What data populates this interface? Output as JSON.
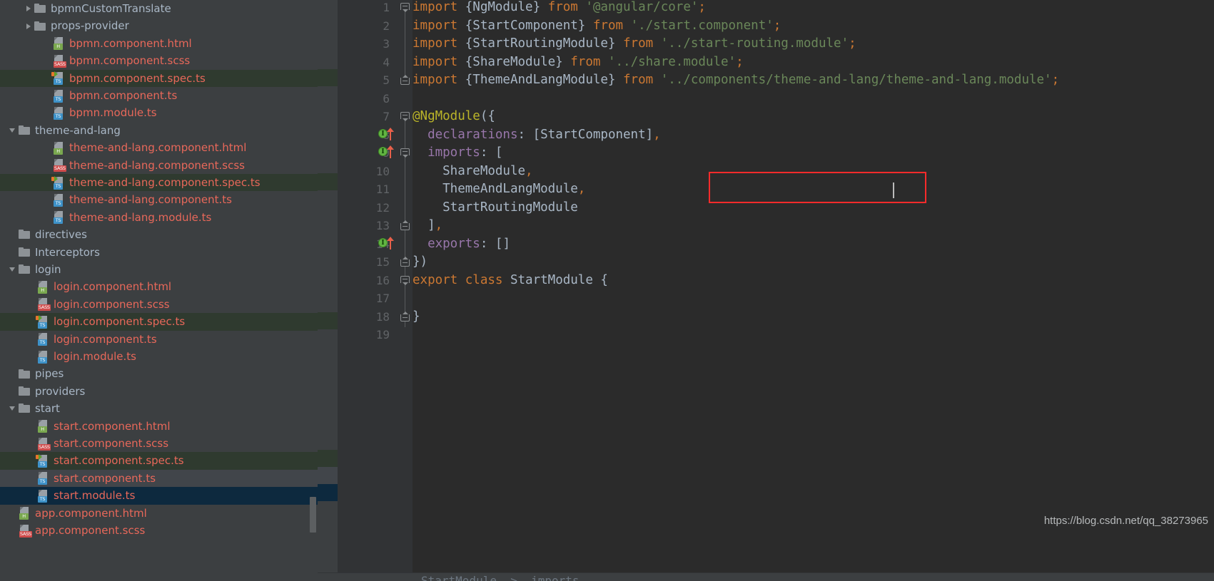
{
  "window": {
    "theme_background": "#2b2b2b",
    "sidebar_background": "#3c3f41",
    "accent_selection_blue": "#0d293e",
    "accent_selection_green": "#2f3a2f",
    "highlight_red": "#ff2b2b"
  },
  "sidebar": {
    "scrollbar": {
      "color": "#5c5f61"
    },
    "items": [
      {
        "label": "bpmnCustomTranslate",
        "kind": "folder",
        "indent": 48,
        "arrow": "right",
        "state": "none"
      },
      {
        "label": "props-provider",
        "kind": "folder",
        "indent": 48,
        "arrow": "right",
        "state": "none"
      },
      {
        "label": "bpmn.component.html",
        "kind": "file",
        "badge": "H",
        "indent": 74,
        "arrow": "none",
        "state": "none"
      },
      {
        "label": "bpmn.component.scss",
        "kind": "file",
        "badge": "SASS",
        "indent": 74,
        "arrow": "none",
        "state": "none"
      },
      {
        "label": "bpmn.component.spec.ts",
        "kind": "file",
        "badge": "TS",
        "spec": true,
        "indent": 74,
        "arrow": "none",
        "state": "green"
      },
      {
        "label": "bpmn.component.ts",
        "kind": "file",
        "badge": "TS",
        "indent": 74,
        "arrow": "none",
        "state": "none"
      },
      {
        "label": "bpmn.module.ts",
        "kind": "file",
        "badge": "TS",
        "indent": 74,
        "arrow": "none",
        "state": "none"
      },
      {
        "label": "theme-and-lang",
        "kind": "folder",
        "indent": 26,
        "arrow": "down",
        "state": "none"
      },
      {
        "label": "theme-and-lang.component.html",
        "kind": "file",
        "badge": "H",
        "indent": 74,
        "arrow": "none",
        "state": "none"
      },
      {
        "label": "theme-and-lang.component.scss",
        "kind": "file",
        "badge": "SASS",
        "indent": 74,
        "arrow": "none",
        "state": "none"
      },
      {
        "label": "theme-and-lang.component.spec.ts",
        "kind": "file",
        "badge": "TS",
        "spec": true,
        "indent": 74,
        "arrow": "none",
        "state": "green"
      },
      {
        "label": "theme-and-lang.component.ts",
        "kind": "file",
        "badge": "TS",
        "indent": 74,
        "arrow": "none",
        "state": "none"
      },
      {
        "label": "theme-and-lang.module.ts",
        "kind": "file",
        "badge": "TS",
        "indent": 74,
        "arrow": "none",
        "state": "none"
      },
      {
        "label": "directives",
        "kind": "folder",
        "indent": 26,
        "arrow": "none",
        "state": "none"
      },
      {
        "label": "Interceptors",
        "kind": "folder",
        "indent": 26,
        "arrow": "none",
        "state": "none"
      },
      {
        "label": "login",
        "kind": "folder",
        "indent": 26,
        "arrow": "down",
        "state": "none"
      },
      {
        "label": "login.component.html",
        "kind": "file",
        "badge": "H",
        "indent": 52,
        "arrow": "none",
        "state": "none"
      },
      {
        "label": "login.component.scss",
        "kind": "file",
        "badge": "SASS",
        "indent": 52,
        "arrow": "none",
        "state": "none"
      },
      {
        "label": "login.component.spec.ts",
        "kind": "file",
        "badge": "TS",
        "spec": true,
        "indent": 52,
        "arrow": "none",
        "state": "green"
      },
      {
        "label": "login.component.ts",
        "kind": "file",
        "badge": "TS",
        "indent": 52,
        "arrow": "none",
        "state": "none"
      },
      {
        "label": "login.module.ts",
        "kind": "file",
        "badge": "TS",
        "indent": 52,
        "arrow": "none",
        "state": "none"
      },
      {
        "label": "pipes",
        "kind": "folder",
        "indent": 26,
        "arrow": "none",
        "state": "none"
      },
      {
        "label": "providers",
        "kind": "folder",
        "indent": 26,
        "arrow": "none",
        "state": "none"
      },
      {
        "label": "start",
        "kind": "folder",
        "indent": 26,
        "arrow": "down",
        "state": "none"
      },
      {
        "label": "start.component.html",
        "kind": "file",
        "badge": "H",
        "indent": 52,
        "arrow": "none",
        "state": "none"
      },
      {
        "label": "start.component.scss",
        "kind": "file",
        "badge": "SASS",
        "indent": 52,
        "arrow": "none",
        "state": "none"
      },
      {
        "label": "start.component.spec.ts",
        "kind": "file",
        "badge": "TS",
        "spec": true,
        "indent": 52,
        "arrow": "none",
        "state": "green"
      },
      {
        "label": "start.component.ts",
        "kind": "file",
        "badge": "TS",
        "indent": 52,
        "arrow": "none",
        "state": "grey"
      },
      {
        "label": "start.module.ts",
        "kind": "file",
        "badge": "TS",
        "indent": 52,
        "arrow": "none",
        "state": "blue"
      },
      {
        "label": "app.component.html",
        "kind": "file",
        "badge": "H",
        "indent": 26,
        "arrow": "none",
        "state": "none"
      },
      {
        "label": "app.component.scss",
        "kind": "file",
        "badge": "SASS",
        "indent": 26,
        "arrow": "none",
        "state": "none"
      }
    ]
  },
  "editor": {
    "line_numbers": [
      "1",
      "2",
      "3",
      "4",
      "5",
      "6",
      "7",
      "8",
      "9",
      "10",
      "11",
      "12",
      "13",
      "14",
      "15",
      "16",
      "17",
      "18",
      "19"
    ],
    "lines": [
      {
        "n": 1,
        "tokens": [
          {
            "t": "import",
            "c": "kw"
          },
          {
            "t": " {NgModule} ",
            "c": "txt"
          },
          {
            "t": "from",
            "c": "kw"
          },
          {
            "t": " ",
            "c": "txt"
          },
          {
            "t": "'@angular/core'",
            "c": "str"
          },
          {
            "t": ";",
            "c": "kw"
          }
        ]
      },
      {
        "n": 2,
        "tokens": [
          {
            "t": "import",
            "c": "kw"
          },
          {
            "t": " {StartComponent} ",
            "c": "txt"
          },
          {
            "t": "from",
            "c": "kw"
          },
          {
            "t": " ",
            "c": "txt"
          },
          {
            "t": "'./start.component'",
            "c": "str"
          },
          {
            "t": ";",
            "c": "kw"
          }
        ]
      },
      {
        "n": 3,
        "tokens": [
          {
            "t": "import",
            "c": "kw"
          },
          {
            "t": " {StartRoutingModule} ",
            "c": "txt"
          },
          {
            "t": "from",
            "c": "kw"
          },
          {
            "t": " ",
            "c": "txt"
          },
          {
            "t": "'../start-routing.module'",
            "c": "str"
          },
          {
            "t": ";",
            "c": "kw"
          }
        ]
      },
      {
        "n": 4,
        "tokens": [
          {
            "t": "import",
            "c": "kw"
          },
          {
            "t": " {ShareModule} ",
            "c": "txt"
          },
          {
            "t": "from",
            "c": "kw"
          },
          {
            "t": " ",
            "c": "txt"
          },
          {
            "t": "'../share.module'",
            "c": "str"
          },
          {
            "t": ";",
            "c": "kw"
          }
        ]
      },
      {
        "n": 5,
        "tokens": [
          {
            "t": "import",
            "c": "kw"
          },
          {
            "t": " {ThemeAndLangModule} ",
            "c": "txt"
          },
          {
            "t": "from",
            "c": "kw"
          },
          {
            "t": " ",
            "c": "txt"
          },
          {
            "t": "'../components/theme-and-lang/theme-and-lang.module'",
            "c": "str"
          },
          {
            "t": ";",
            "c": "kw"
          }
        ]
      },
      {
        "n": 6,
        "tokens": []
      },
      {
        "n": 7,
        "tokens": [
          {
            "t": "@NgModule",
            "c": "ann"
          },
          {
            "t": "({",
            "c": "txt"
          }
        ]
      },
      {
        "n": 8,
        "tokens": [
          {
            "t": "  ",
            "c": "txt"
          },
          {
            "t": "declarations",
            "c": "prop"
          },
          {
            "t": ": [StartComponent]",
            "c": "txt"
          },
          {
            "t": ",",
            "c": "kw"
          }
        ]
      },
      {
        "n": 9,
        "tokens": [
          {
            "t": "  ",
            "c": "txt"
          },
          {
            "t": "imports",
            "c": "prop"
          },
          {
            "t": ": [",
            "c": "txt"
          }
        ]
      },
      {
        "n": 10,
        "tokens": [
          {
            "t": "    ShareModule",
            "c": "txt"
          },
          {
            "t": ",",
            "c": "kw"
          }
        ]
      },
      {
        "n": 11,
        "tokens": [
          {
            "t": "    ThemeAndLangModule",
            "c": "txt"
          },
          {
            "t": ",",
            "c": "kw"
          }
        ]
      },
      {
        "n": 12,
        "tokens": [
          {
            "t": "    StartRoutingModule",
            "c": "txt"
          }
        ]
      },
      {
        "n": 13,
        "tokens": [
          {
            "t": "  ]",
            "c": "txt"
          },
          {
            "t": ",",
            "c": "kw"
          }
        ]
      },
      {
        "n": 14,
        "tokens": [
          {
            "t": "  ",
            "c": "txt"
          },
          {
            "t": "exports",
            "c": "prop"
          },
          {
            "t": ": []",
            "c": "txt"
          }
        ]
      },
      {
        "n": 15,
        "tokens": [
          {
            "t": "})",
            "c": "txt"
          }
        ]
      },
      {
        "n": 16,
        "tokens": [
          {
            "t": "export class",
            "c": "kw"
          },
          {
            "t": " StartModule {",
            "c": "txt"
          }
        ]
      },
      {
        "n": 17,
        "tokens": []
      },
      {
        "n": 18,
        "tokens": [
          {
            "t": "}",
            "c": "txt"
          }
        ]
      },
      {
        "n": 19,
        "tokens": []
      }
    ],
    "gutter_markers": [
      {
        "line": 8,
        "type": "implemented-marker"
      },
      {
        "line": 9,
        "type": "implemented-marker"
      },
      {
        "line": 11,
        "type": "intention-bulb"
      },
      {
        "line": 14,
        "type": "implemented-marker"
      }
    ],
    "fold_markers": [
      {
        "line": 1,
        "type": "top"
      },
      {
        "line": 5,
        "type": "bottom"
      },
      {
        "line": 7,
        "type": "top"
      },
      {
        "line": 9,
        "type": "top"
      },
      {
        "line": 13,
        "type": "bottom"
      },
      {
        "line": 15,
        "type": "bottom"
      },
      {
        "line": 16,
        "type": "top"
      },
      {
        "line": 18,
        "type": "bottom"
      }
    ],
    "caret": {
      "line": 11,
      "after_text": "ThemeAndLangModule,"
    },
    "annotation_box": {
      "label": "red-highlight-rectangle",
      "lines": [
        10,
        11
      ]
    },
    "syntax_colors": {
      "keyword": "#cc7832",
      "text": "#a9b7c6",
      "string": "#6a8759",
      "annotation": "#bbb529",
      "property": "#9876aa",
      "line_number": "#606366"
    }
  },
  "watermark": {
    "text": "https://blog.csdn.net/qq_38273965"
  },
  "bottom_ghost": {
    "text": "StartModule  >  imports"
  }
}
